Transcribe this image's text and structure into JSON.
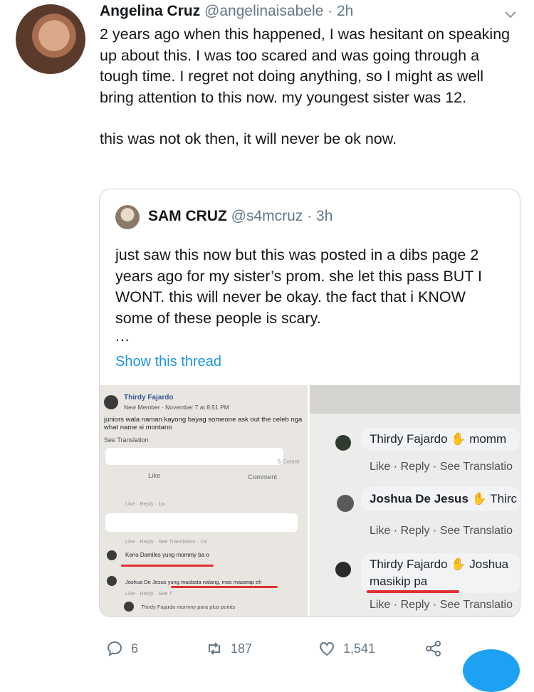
{
  "tweet": {
    "display_name": "Angelina Cruz",
    "handle": "@angelinaisabele",
    "separator": "·",
    "time": "2h",
    "paragraphs": [
      "2 years ago when this happened, I was hesitant on speaking up about this. I was too scared and was going through a tough time. I regret not doing anything, so I might as well bring attention to this now. my youngest sister was 12.",
      "this was not ok then, it will never be ok now."
    ]
  },
  "quoted": {
    "display_name": "SAM CRUZ",
    "handle": "@s4mcruz",
    "separator": "·",
    "time": "3h",
    "text": "just saw this now but this was posted in a dibs page 2 years ago for my sister’s prom. she let this pass BUT I WONT. this will never be okay. the fact that i KNOW some of these people is scary.",
    "ellipsis": "...",
    "show_thread": "Show this thread",
    "image_left": {
      "poster": "Thirdy Fajardo",
      "member_line": "New Member · November 7 at 8:51 PM",
      "post_text": "juniors wala naman kayong bayag someone ask out the celeb nga what name si montano",
      "see_translation": "See Translation",
      "comments_count": "6 Comm",
      "like": "Like",
      "comment": "Comment",
      "actions_a": "Like · Reply · 1w",
      "actions_b": "Like · Reply · See Translation · 1w",
      "comment_1": "Keno Damiles yung mommy ba o",
      "comment_2": "Joshua De Jesus yung masbata nalang, mas masarap eh",
      "actions_c": "Like · Reply · See T",
      "comment_3": "Thirdy Fajardo mommy para plus points"
    },
    "image_right": {
      "c1_name": "Thirdy Fajardo",
      "c1_text": "momm",
      "c2_name": "Joshua De Jesus",
      "c2_text": "Thirc",
      "c3_name": "Thirdy Fajardo",
      "c3_text": "Joshua",
      "c3_line2": "masikip pa",
      "like_reply": "Like · Reply · See Translatio"
    }
  },
  "actions": {
    "replies": "6",
    "retweets": "187",
    "likes": "1,541"
  },
  "colors": {
    "link": "#1b95e0",
    "muted": "#657786",
    "border": "#ccd6dd",
    "accent_underline": "#e0302f"
  }
}
